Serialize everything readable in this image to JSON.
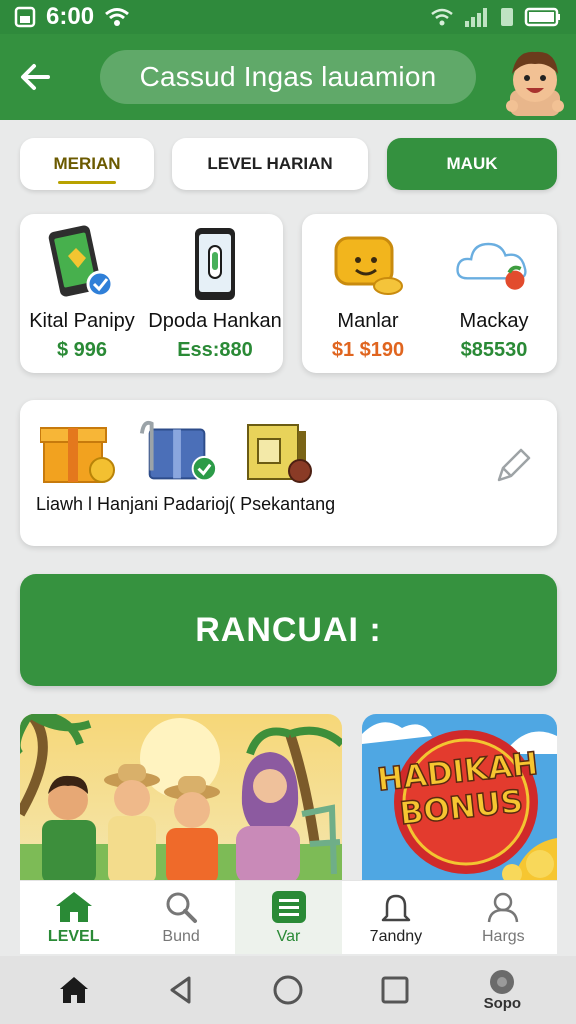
{
  "status": {
    "time": "6:00"
  },
  "header": {
    "title": "Cassud Ingas lauamion"
  },
  "tabs": [
    {
      "label": "MERIAN"
    },
    {
      "label": "LEVEL HARIAN"
    },
    {
      "label": "MAUK"
    }
  ],
  "products": [
    {
      "name": "Kital Panipy",
      "price": "$ 996",
      "icon": "phone-card-icon"
    },
    {
      "name": "Dpoda Hankan",
      "price": "Ess:880",
      "icon": "phone-icon"
    },
    {
      "name": "Manlar",
      "price": "$1 $190",
      "icon": "gold-coin-chest-icon"
    },
    {
      "name": "Mackay",
      "price": "$85530",
      "icon": "cloud-icon"
    }
  ],
  "bundle": {
    "label": "Liawh l Hanjani Padarioj( Psekantang"
  },
  "cta": {
    "label": "RANCUAI :"
  },
  "promo": {
    "bonus_line1": "HADIKAH",
    "bonus_line2": "BONUS"
  },
  "bottom_nav": [
    {
      "label": "LEVEL",
      "icon": "home-icon"
    },
    {
      "label": "Bund",
      "icon": "search-icon"
    },
    {
      "label": "Var",
      "icon": "menu-icon"
    },
    {
      "label": "7andny",
      "icon": "bell-icon"
    },
    {
      "label": "Hargs",
      "icon": "profile-icon"
    }
  ],
  "system_nav": {
    "extra_label": "Sopo"
  },
  "colors": {
    "primary": "#34913f",
    "accent_orange": "#e0651f",
    "price_green": "#2a8a36"
  }
}
